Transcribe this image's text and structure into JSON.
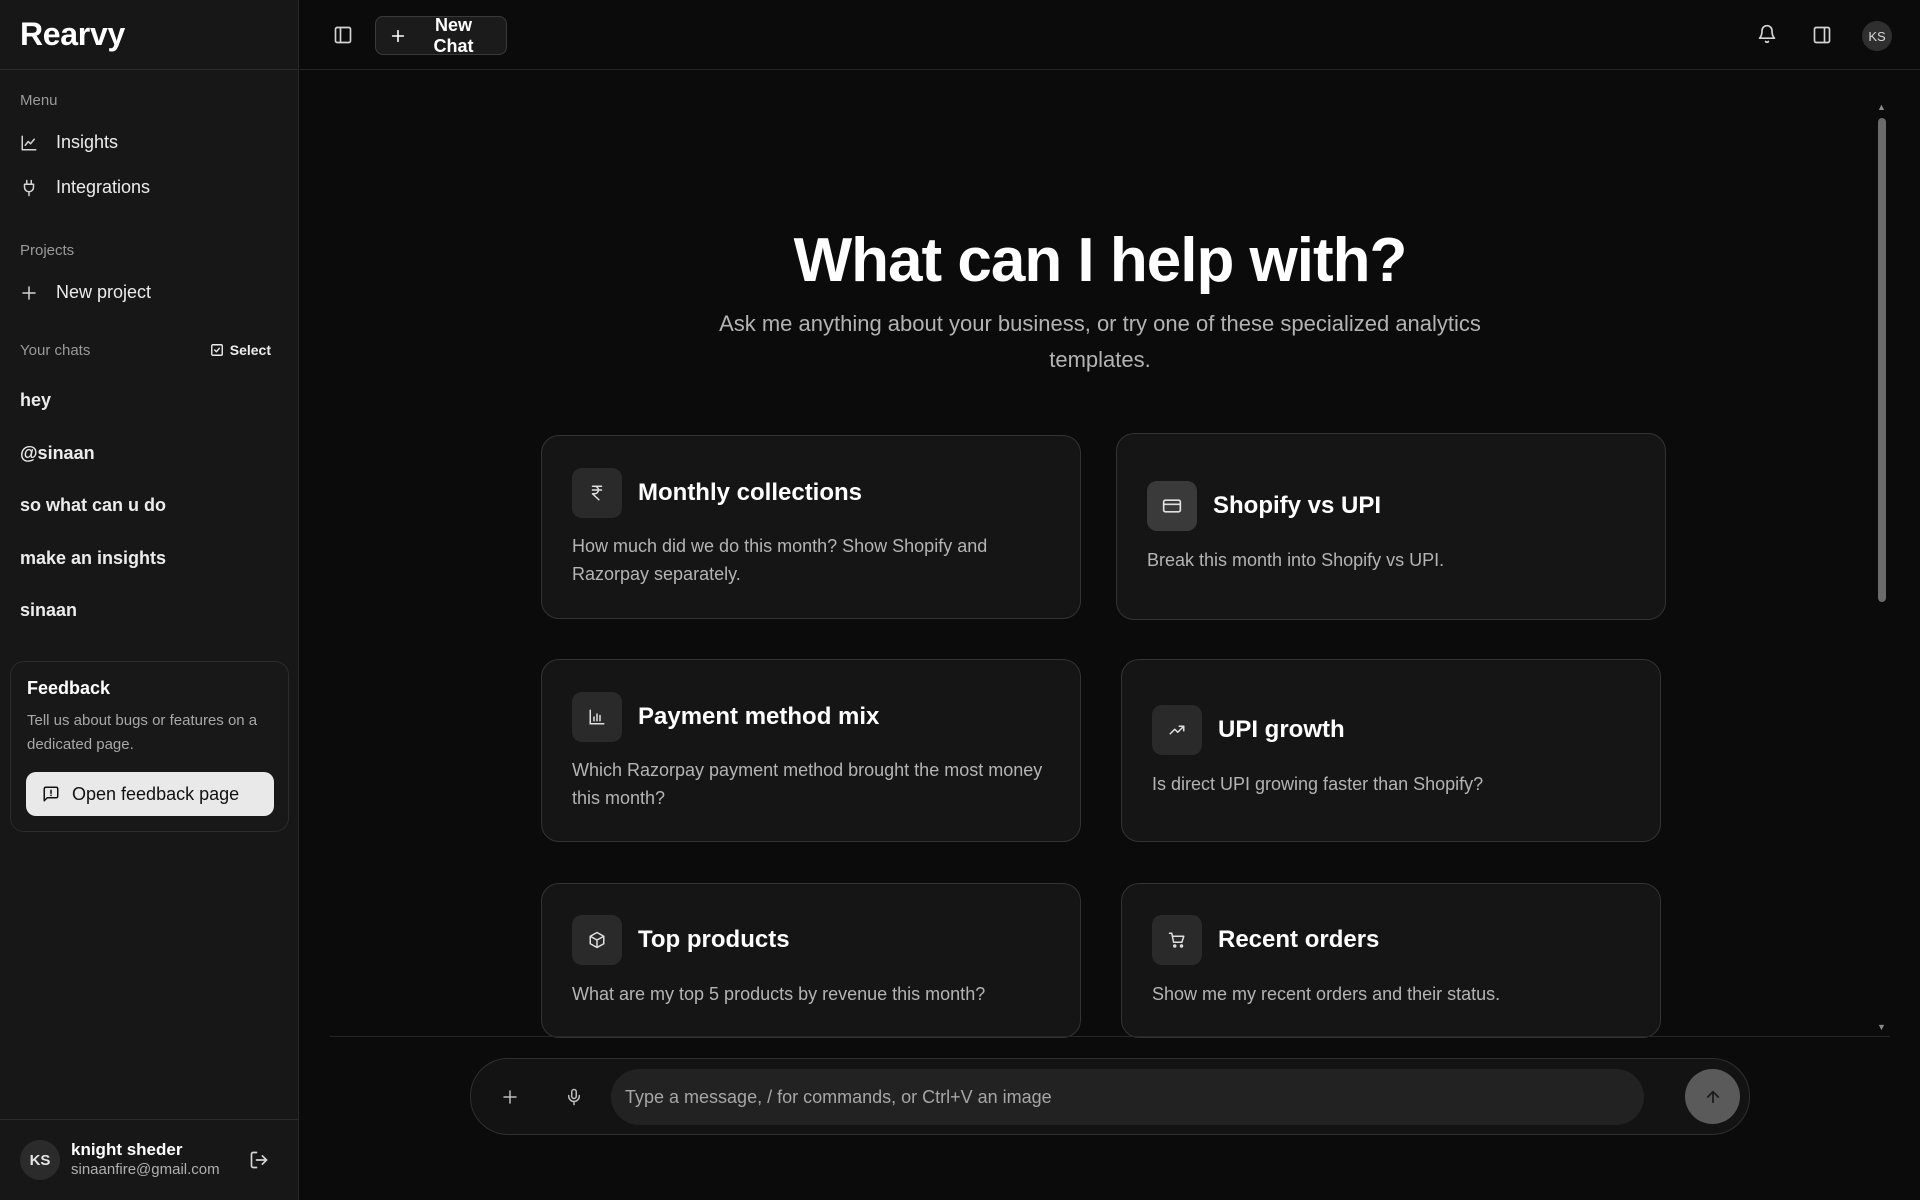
{
  "app": {
    "name": "Rearvy"
  },
  "sidebar": {
    "menu_label": "Menu",
    "menu_items": [
      {
        "label": "Insights",
        "icon": "line-chart-icon"
      },
      {
        "label": "Integrations",
        "icon": "plug-icon"
      }
    ],
    "projects_label": "Projects",
    "new_project_label": "New project",
    "chats_label": "Your chats",
    "select_label": "Select",
    "chats": [
      "hey",
      "@sinaan",
      "so what can u do",
      "make an insights",
      "sinaan"
    ],
    "feedback": {
      "title": "Feedback",
      "text": "Tell us about bugs or features on a dedicated page.",
      "button_label": "Open feedback page"
    },
    "user": {
      "initials": "KS",
      "name": "knight sheder",
      "email": "sinaanfire@gmail.com"
    }
  },
  "header": {
    "new_chat_label": "New Chat",
    "avatar_initials": "KS"
  },
  "main": {
    "title": "What can I help with?",
    "subtitle": "Ask me anything about your business, or try one of these specialized analytics templates.",
    "cards": [
      {
        "icon": "rupee-icon",
        "title": "Monthly collections",
        "desc": "How much did we do this month? Show Shopify and Razorpay separately."
      },
      {
        "icon": "credit-card-icon",
        "title": "Shopify vs UPI",
        "desc": "Break this month into Shopify vs UPI."
      },
      {
        "icon": "bar-chart-icon",
        "title": "Payment method mix",
        "desc": "Which Razorpay payment method brought the most money this month?"
      },
      {
        "icon": "trending-up-icon",
        "title": "UPI growth",
        "desc": "Is direct UPI growing faster than Shopify?"
      },
      {
        "icon": "package-icon",
        "title": "Top products",
        "desc": "What are my top 5 products by revenue this month?"
      },
      {
        "icon": "shopping-cart-icon",
        "title": "Recent orders",
        "desc": "Show me my recent orders and their status."
      }
    ]
  },
  "composer": {
    "placeholder": "Type a message, / for commands, or Ctrl+V an image"
  }
}
